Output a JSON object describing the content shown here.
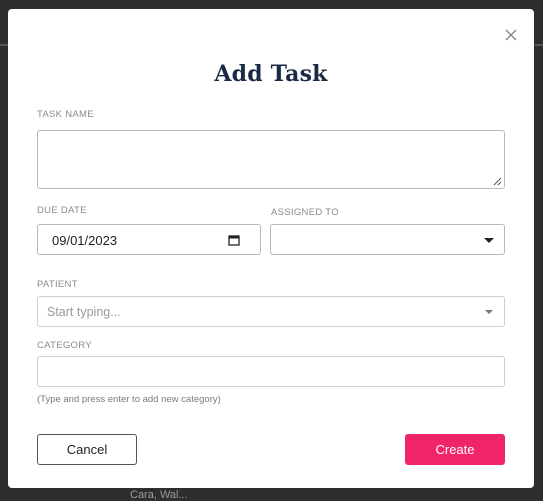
{
  "backdrop": {
    "peek_text": "Cara, Wal..."
  },
  "modal": {
    "title": "Add Task",
    "close_icon": "close-icon",
    "task_name": {
      "label": "TASK NAME",
      "value": ""
    },
    "due_date": {
      "label": "DUE DATE",
      "value": "09/01/2023",
      "icon": "calendar-icon"
    },
    "assigned_to": {
      "label": "ASSIGNED TO",
      "value": "",
      "icon": "caret-down-icon"
    },
    "patient": {
      "label": "PATIENT",
      "placeholder": "Start typing...",
      "icon": "caret-down-icon"
    },
    "category": {
      "label": "CATEGORY",
      "value": "",
      "hint": "(Type and press enter to add new category)"
    },
    "buttons": {
      "cancel": "Cancel",
      "create": "Create"
    }
  },
  "colors": {
    "title": "#1b2a44",
    "create_button": "#f02468",
    "label": "#8a8a8a"
  }
}
